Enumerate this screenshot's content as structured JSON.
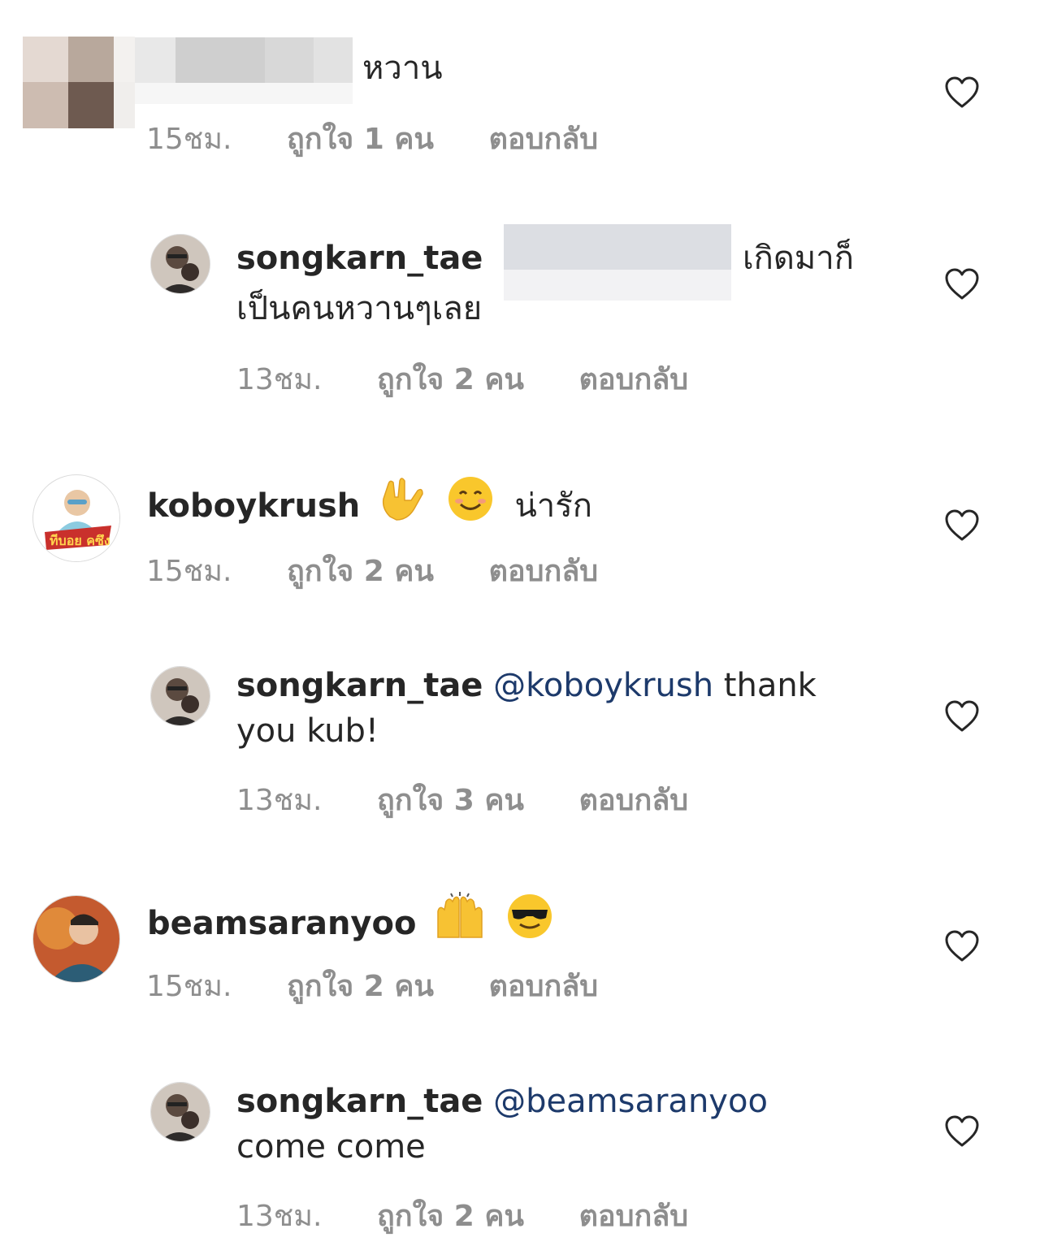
{
  "comments": [
    {
      "text": "หวาน",
      "time": "15ชม.",
      "likes": "ถูกใจ 1 คน",
      "reply": "ตอบกลับ"
    },
    {
      "username": "songkarn_tae",
      "text_line1_end": "เกิดมาก็",
      "text_line2": "เป็นคนหวานๆเลย",
      "time": "13ชม.",
      "likes": "ถูกใจ 2 คน",
      "reply": "ตอบกลับ"
    },
    {
      "username": "koboykrush",
      "emojis": [
        "love-you-gesture",
        "smiling-face-with-smiling-eyes"
      ],
      "text": "น่ารัก",
      "avatar_text": "ทีบอย คซึง",
      "time": "15ชม.",
      "likes": "ถูกใจ 2 คน",
      "reply": "ตอบกลับ"
    },
    {
      "username": "songkarn_tae",
      "mention": "@koboykrush",
      "text_line1": "thank",
      "text_line2": "you kub!",
      "time": "13ชม.",
      "likes": "ถูกใจ 3 คน",
      "reply": "ตอบกลับ"
    },
    {
      "username": "beamsaranyoo",
      "emojis": [
        "raising-hands",
        "smiling-face-with-sunglasses"
      ],
      "time": "15ชม.",
      "likes": "ถูกใจ 2 คน",
      "reply": "ตอบกลับ"
    },
    {
      "username": "songkarn_tae",
      "mention": "@beamsaranyoo",
      "text_line2": "come come",
      "time": "13ชม.",
      "likes": "ถูกใจ 2 คน",
      "reply": "ตอบกลับ"
    }
  ],
  "colors": {
    "text": "#262626",
    "meta": "#8e8e8e",
    "mention": "#1d3a6b",
    "heart": "#262626"
  },
  "icons": {
    "heart": "heart-outline-icon"
  }
}
